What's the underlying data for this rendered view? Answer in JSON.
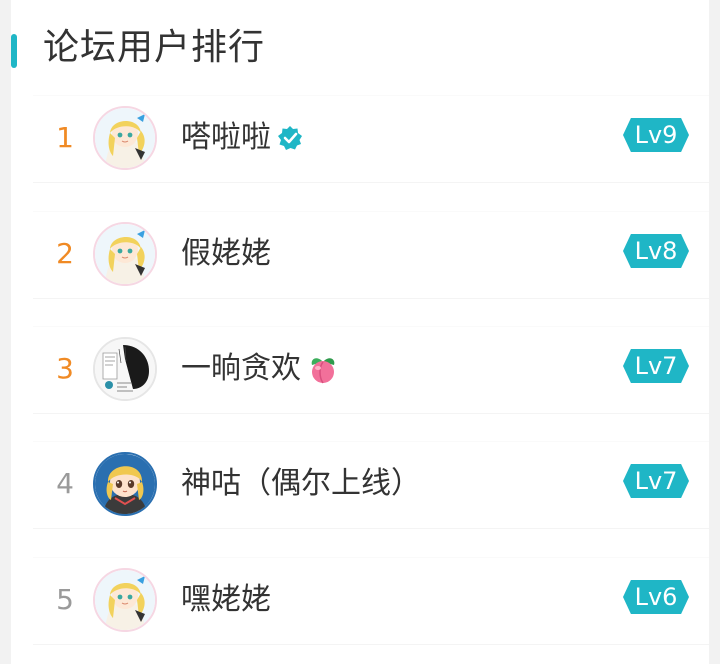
{
  "panel": {
    "title": "论坛用户排行",
    "accent_color": "#1fb6c6"
  },
  "users": [
    {
      "rank": "1",
      "name": "嗒啦啦",
      "level": "Lv9",
      "badge_icon": "verified-check-icon",
      "avatar": "anime-girl-avatar"
    },
    {
      "rank": "2",
      "name": "假姥姥",
      "level": "Lv8",
      "avatar": "anime-girl-avatar"
    },
    {
      "rank": "3",
      "name": "一晌贪欢",
      "level": "Lv7",
      "badge_icon": "peach-icon",
      "avatar": "manga-sketch-avatar"
    },
    {
      "rank": "4",
      "name": "神咕（偶尔上线）",
      "level": "Lv7",
      "avatar": "chibi-girl-avatar"
    },
    {
      "rank": "5",
      "name": "嘿姥姥",
      "level": "Lv6",
      "avatar": "anime-girl-avatar"
    }
  ],
  "colors": {
    "top_rank": "#f08a24",
    "other_rank": "#9a9a9a",
    "level_badge": "#1fb6c6",
    "text": "#333333"
  }
}
